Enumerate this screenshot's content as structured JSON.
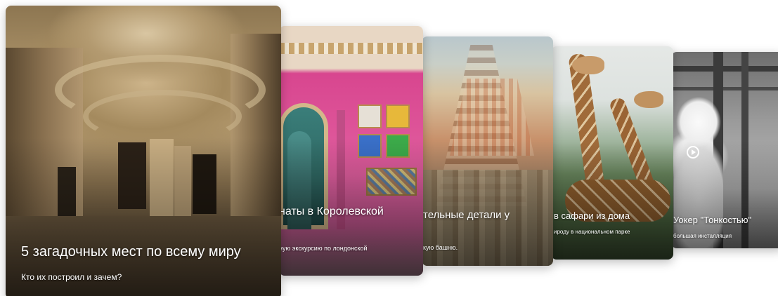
{
  "cards": [
    {
      "title": "5 загадочных мест по всему миру",
      "subtitle": "Кто их построил и зачем?"
    },
    {
      "title": "наты в Королевской",
      "subtitle": "ную экскурсию по лондонской"
    },
    {
      "title": "тельные детали у",
      "subtitle": "кую башню."
    },
    {
      "title": "в сафари из дома",
      "subtitle": "ироду в национальном парке"
    },
    {
      "title": "Уокер \"Тонкостью\"",
      "subtitle": "большая инсталляция",
      "media_icon": "play-icon"
    }
  ],
  "colors": {
    "text": "#ffffff",
    "background": "#ffffff",
    "pink_wall": "#e25fa0"
  }
}
